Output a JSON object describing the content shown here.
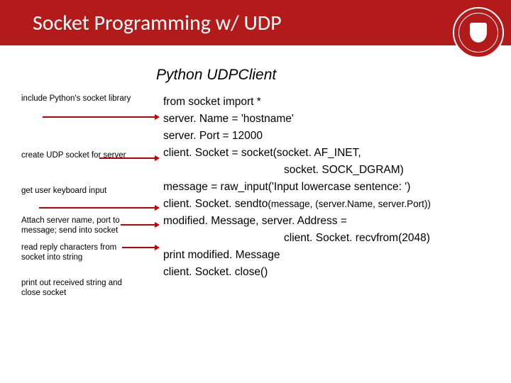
{
  "header": {
    "title": "Socket Programming w/ UDP"
  },
  "subtitle": "Python UDPClient",
  "annotations": {
    "a1": "include Python's socket library",
    "a2": "create UDP socket for server",
    "a3": "get user keyboard input",
    "a4": "Attach server name, port to message; send into socket",
    "a5": "read reply characters from socket into string",
    "a6": "print out received string and close socket"
  },
  "code": {
    "l1": "from socket import *",
    "l2": "server. Name = 'hostname'",
    "l3": "server. Port = 12000",
    "l4": "client. Socket = socket(socket. AF_INET,",
    "l5": "socket. SOCK_DGRAM)",
    "l6": "message = raw_input('Input lowercase sentence: ')",
    "l7a": "client. Socket. sendto",
    "l7b": "(message, (server.Name, server.Port))",
    "l8": "modified. Message, server. Address =",
    "l9": "client. Socket. recvfrom(2048)",
    "l10": "print modified. Message",
    "l11": "client. Socket. close()"
  }
}
